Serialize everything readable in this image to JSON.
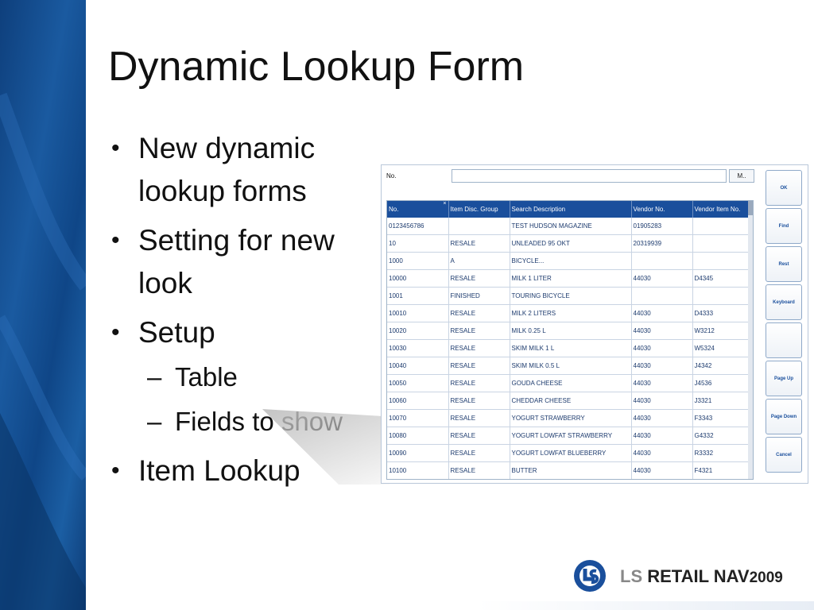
{
  "slide": {
    "title": "Dynamic Lookup Form",
    "bullets": [
      {
        "text": "New dynamic lookup forms"
      },
      {
        "text": "Setting for new look"
      },
      {
        "text": "Setup"
      },
      {
        "text": "Item Lookup"
      }
    ],
    "sub_bullets": [
      "Table",
      "Fields to show"
    ]
  },
  "lookup_form": {
    "field_label": "No.",
    "field_value": "",
    "field_button": "M..",
    "columns": [
      "No.",
      "Item Disc. Group",
      "Search Description",
      "Vendor No.",
      "Vendor Item No."
    ],
    "rows": [
      [
        "0123456786",
        "",
        "TEST HUDSON MAGAZINE",
        "01905283",
        ""
      ],
      [
        "10",
        "RESALE",
        "UNLEADED 95 OKT",
        "20319939",
        ""
      ],
      [
        "1000",
        "A",
        "BICYCLE...",
        "",
        ""
      ],
      [
        "10000",
        "RESALE",
        "MILK 1 LITER",
        "44030",
        "D4345"
      ],
      [
        "1001",
        "FINISHED",
        "TOURING BICYCLE",
        "",
        ""
      ],
      [
        "10010",
        "RESALE",
        "MILK 2 LITERS",
        "44030",
        "D4333"
      ],
      [
        "10020",
        "RESALE",
        "MILK 0.25 L",
        "44030",
        "W3212"
      ],
      [
        "10030",
        "RESALE",
        "SKIM MILK 1 L",
        "44030",
        "W5324"
      ],
      [
        "10040",
        "RESALE",
        "SKIM MILK 0.5 L",
        "44030",
        "J4342"
      ],
      [
        "10050",
        "RESALE",
        "GOUDA CHEESE",
        "44030",
        "J4536"
      ],
      [
        "10060",
        "RESALE",
        "CHEDDAR CHEESE",
        "44030",
        "J3321"
      ],
      [
        "10070",
        "RESALE",
        "YOGURT STRAWBERRY",
        "44030",
        "F3343"
      ],
      [
        "10080",
        "RESALE",
        "YOGURT LOWFAT STRAWBERRY",
        "44030",
        "G4332"
      ],
      [
        "10090",
        "RESALE",
        "YOGURT LOWFAT BLUEBERRY",
        "44030",
        "R3332"
      ],
      [
        "10100",
        "RESALE",
        "BUTTER",
        "44030",
        "F4321"
      ]
    ],
    "buttons": [
      "OK",
      "Find",
      "Rest",
      "Keyboard",
      "",
      "Page Up",
      "Page Down",
      "Cancel"
    ]
  },
  "branding": {
    "logo_ls": "LS",
    "logo_text": "RETAIL NAV",
    "logo_year": "2009"
  },
  "colors": {
    "header_blue": "#1a4f9c",
    "band_blue": "#1a5aa0"
  }
}
